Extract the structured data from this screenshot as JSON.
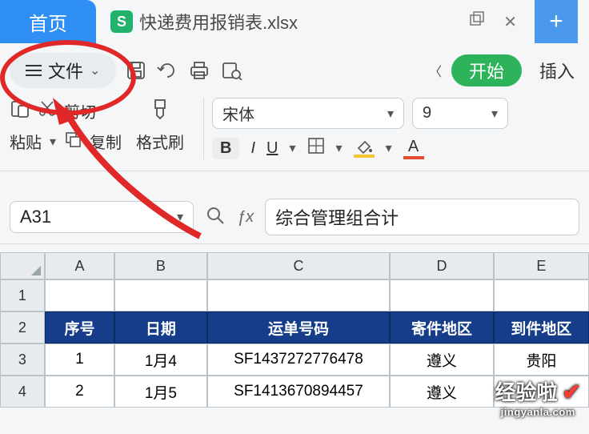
{
  "tabs": {
    "home": "首页",
    "document": "快递费用报销表.xlsx"
  },
  "ribbon": {
    "file": "文件",
    "start": "开始",
    "insert": "插入",
    "cut": "剪切",
    "copy": "复制",
    "paste": "粘贴",
    "format_painter": "格式刷",
    "font_name": "宋体",
    "font_size": "9",
    "bold": "B",
    "italic": "I",
    "underline": "U",
    "font_letter": "A"
  },
  "address": {
    "cell_ref": "A31",
    "formula": "综合管理组合计"
  },
  "columns": [
    "A",
    "B",
    "C",
    "D",
    "E"
  ],
  "row_numbers": [
    "1",
    "2",
    "3",
    "4"
  ],
  "table": {
    "headers": [
      "序号",
      "日期",
      "运单号码",
      "寄件地区",
      "到件地区"
    ],
    "rows": [
      {
        "no": "1",
        "date": "1月4",
        "tracking": "SF1437272776478",
        "from": "遵义",
        "to": "贵阳"
      },
      {
        "no": "2",
        "date": "1月5",
        "tracking": "SF1413670894457",
        "from": "遵义",
        "to": ""
      }
    ]
  },
  "watermark": {
    "title": "经验啦",
    "sub": "jingyanla.com"
  }
}
